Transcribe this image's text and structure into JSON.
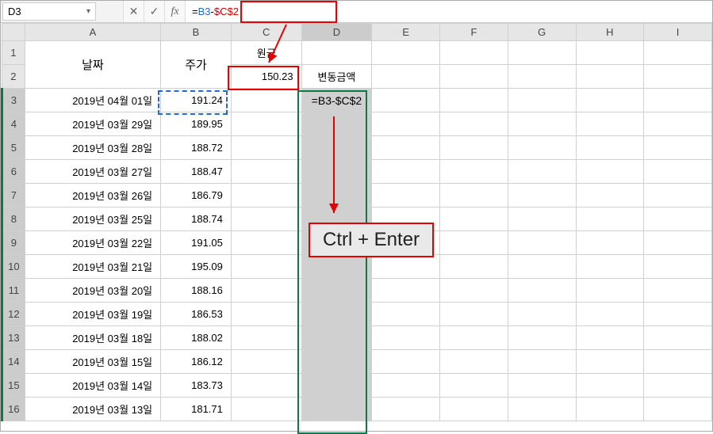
{
  "namebox": {
    "value": "D3"
  },
  "formula_bar": {
    "eq": "=",
    "ref1": "B3",
    "minus": "-",
    "ref2": "$C$2"
  },
  "columns": [
    "A",
    "B",
    "C",
    "D",
    "E",
    "F",
    "G",
    "H",
    "I"
  ],
  "row_numbers": [
    "1",
    "2",
    "3",
    "4",
    "5",
    "6",
    "7",
    "8",
    "9",
    "10",
    "11",
    "12",
    "13",
    "14",
    "15",
    "16"
  ],
  "headers": {
    "date": "날짜",
    "price": "주가",
    "principal_label": "원금",
    "principal_value": "150.23",
    "change_label": "변동금액"
  },
  "d3_inline": "=B3-$C$2",
  "callout": "Ctrl + Enter",
  "rows": [
    {
      "date": "2019년 04월 01일",
      "price": "191.24"
    },
    {
      "date": "2019년 03월 29일",
      "price": "189.95"
    },
    {
      "date": "2019년 03월 28일",
      "price": "188.72"
    },
    {
      "date": "2019년 03월 27일",
      "price": "188.47"
    },
    {
      "date": "2019년 03월 26일",
      "price": "186.79"
    },
    {
      "date": "2019년 03월 25일",
      "price": "188.74"
    },
    {
      "date": "2019년 03월 22일",
      "price": "191.05"
    },
    {
      "date": "2019년 03월 21일",
      "price": "195.09"
    },
    {
      "date": "2019년 03월 20일",
      "price": "188.16"
    },
    {
      "date": "2019년 03월 19일",
      "price": "186.53"
    },
    {
      "date": "2019년 03월 18일",
      "price": "188.02"
    },
    {
      "date": "2019년 03월 15일",
      "price": "186.12"
    },
    {
      "date": "2019년 03월 14일",
      "price": "183.73"
    },
    {
      "date": "2019년 03월 13일",
      "price": "181.71"
    }
  ]
}
